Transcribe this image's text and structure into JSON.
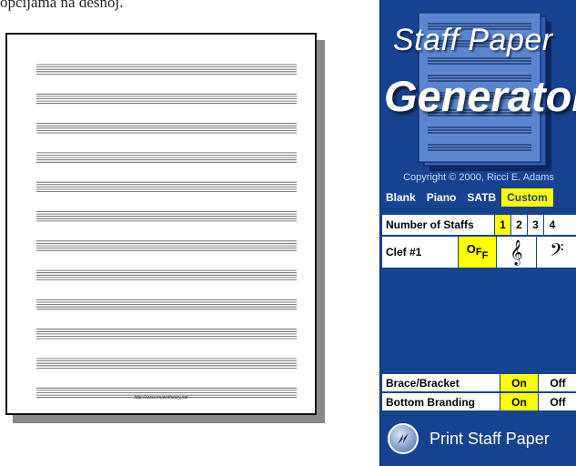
{
  "caption": "opcijama na desnoj.",
  "paper": {
    "url": "http://www.musictheory.net",
    "staff_count": 12
  },
  "generator": {
    "title_line1": "Staff Paper",
    "title_line2": "Generator",
    "copyright": "Copyright © 2000, Ricci E. Adams",
    "presets": [
      "Blank",
      "Piano",
      "SATB",
      "Custom"
    ],
    "active_preset": "Custom",
    "number_of_staffs": {
      "label": "Number of Staffs",
      "options": [
        "1",
        "2",
        "3",
        "4"
      ],
      "selected": "1"
    },
    "clef": {
      "label": "Clef #1",
      "off_label": "OFF",
      "treble_symbol": "𝄞",
      "bass_symbol": "𝄢",
      "selected": "OFF"
    },
    "brace_bracket": {
      "label": "Brace/Bracket",
      "on_label": "On",
      "off_label": "Off",
      "selected": "On"
    },
    "bottom_branding": {
      "label": "Bottom Branding",
      "on_label": "On",
      "off_label": "Off",
      "selected": "On"
    },
    "print_label": "Print Staff Paper"
  },
  "colors": {
    "panel_bg": "#16438f",
    "highlight": "#ffff00"
  }
}
